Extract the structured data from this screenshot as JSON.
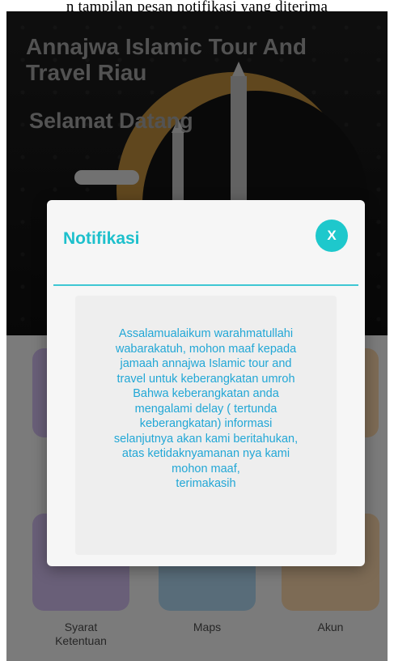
{
  "caption": "n tampilan pesan notifikasi yang diterima",
  "app": {
    "title": "Annajwa Islamic Tour And Travel Riau",
    "welcome": "Selamat Datang"
  },
  "menu": {
    "items": [
      {
        "label": "Syarat\nKetentuan",
        "icon": "document-icon"
      },
      {
        "label": "Maps",
        "icon": "map-icon"
      },
      {
        "label": "Akun",
        "icon": "user-icon"
      }
    ]
  },
  "dialog": {
    "title": "Notifikasi",
    "close_label": "X",
    "message": "Assalamualaikum warahmatullahi\nwabarakatuh,  mohon maaf kepada\njamaah annajwa Islamic tour and\ntravel untuk keberangkatan umroh\nBahwa keberangkatan anda\nmengalami delay ( tertunda\nkeberangkatan) informasi\nselanjutnya akan kami beritahukan,\natas ketidaknyamanan nya kami\nmohon maaf,\nterimakasih"
  },
  "colors": {
    "accent": "#1ec8cc",
    "message_text": "#22a7d6"
  }
}
